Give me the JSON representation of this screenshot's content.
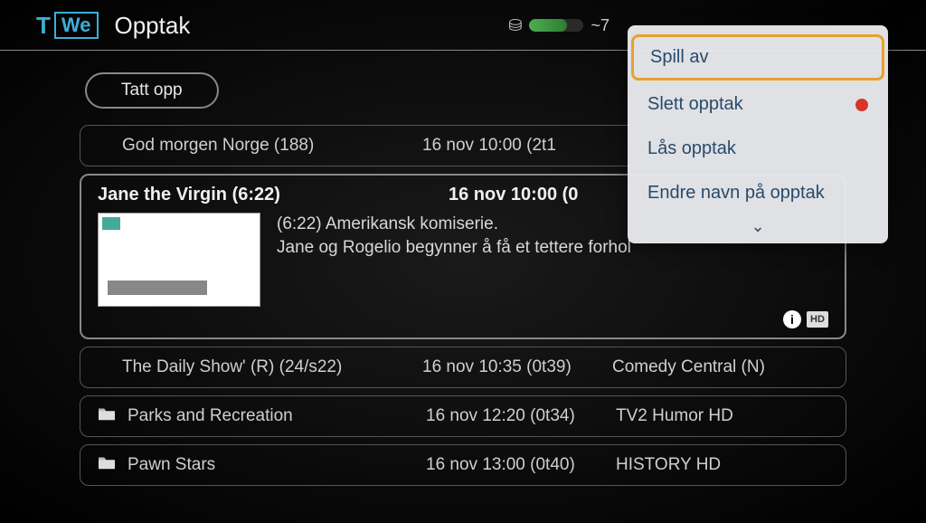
{
  "logo": {
    "part1": "T",
    "part2": "We"
  },
  "page_title": "Opptak",
  "capacity_prefix": "~7",
  "tabs": {
    "recorded": "Tatt opp"
  },
  "recordings": [
    {
      "title": "God morgen Norge (188)",
      "time": "16 nov 10:00 (2t1",
      "channel": ""
    },
    {
      "title": "Jane the Virgin (6:22)",
      "time": "16 nov 10:00 (0",
      "desc_line1": "(6:22) Amerikansk komiserie.",
      "desc_line2": "Jane og Rogelio begynner å få et tettere forhol",
      "info": "i",
      "hd": "HD"
    },
    {
      "title": "The Daily Show' (R) (24/s22)",
      "time": "16 nov 10:35 (0t39)",
      "channel": "Comedy Central (N)"
    },
    {
      "title": "Parks and Recreation",
      "time": "16 nov 12:20 (0t34)",
      "channel": "TV2 Humor HD",
      "folder": true
    },
    {
      "title": "Pawn Stars",
      "time": "16 nov 13:00 (0t40)",
      "channel": "HISTORY HD",
      "folder": true
    }
  ],
  "menu": {
    "play": "Spill av",
    "delete": "Slett opptak",
    "lock": "Lås opptak",
    "rename": "Endre navn på opptak"
  }
}
